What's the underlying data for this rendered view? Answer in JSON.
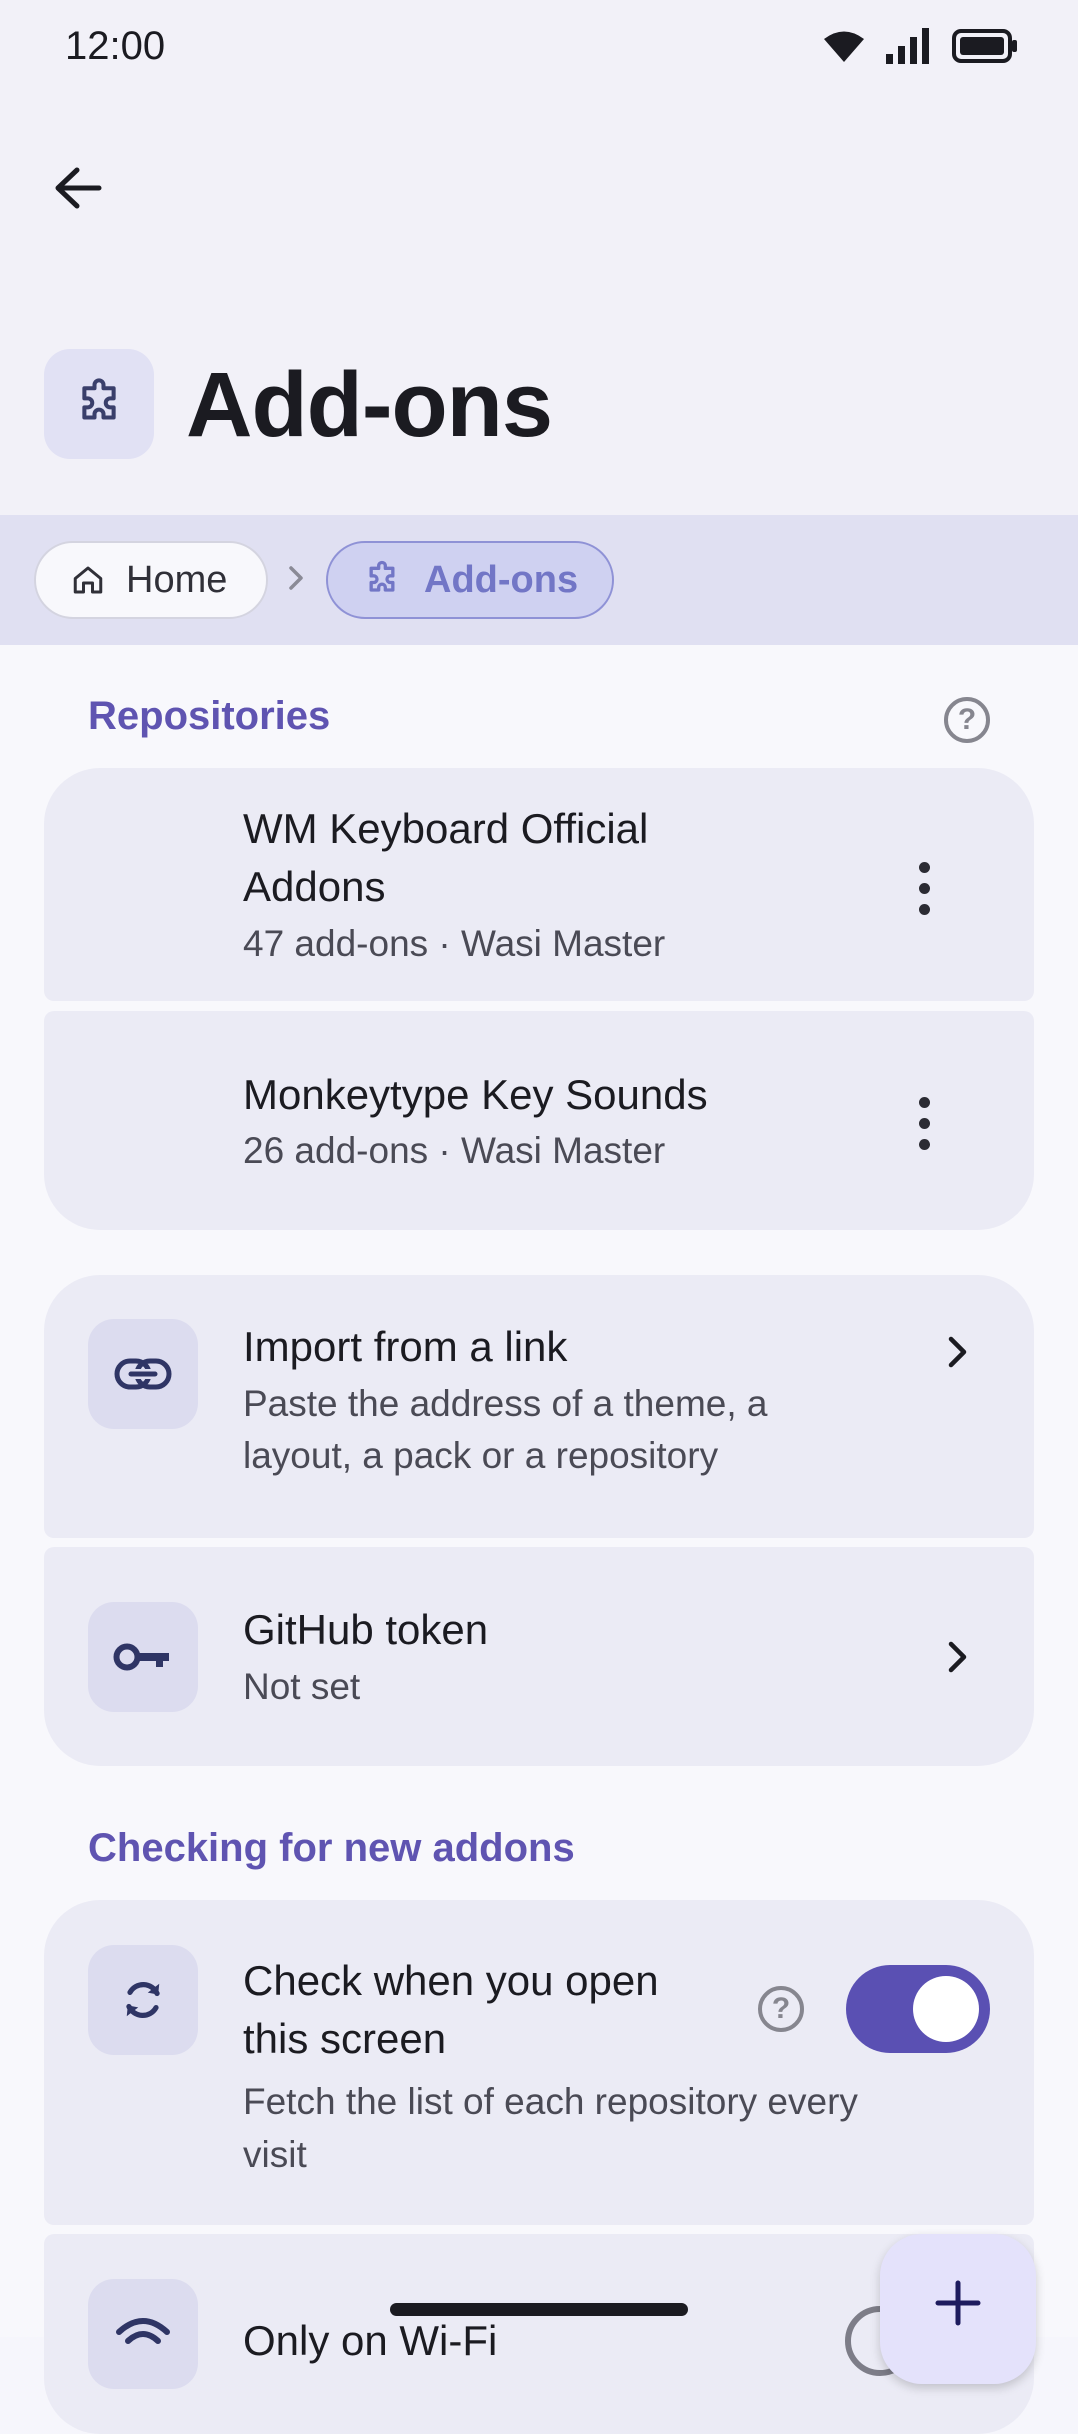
{
  "status_bar": {
    "time": "12:00"
  },
  "header": {
    "title": "Add-ons",
    "title_icon": "puzzle-icon"
  },
  "breadcrumb": {
    "items": [
      {
        "label": "Home",
        "icon": "home-icon"
      },
      {
        "label": "Add-ons",
        "icon": "puzzle-icon"
      }
    ]
  },
  "repositories": {
    "section_title": "Repositories",
    "items": [
      {
        "title_line1": "WM Keyboard Official",
        "title_line2": "Addons",
        "subtitle": "47 add-ons · Wasi Master"
      },
      {
        "title": "Monkeytype Key Sounds",
        "subtitle": "26 add-ons · Wasi Master"
      }
    ]
  },
  "actions": {
    "import": {
      "title": "Import from a link",
      "subtitle_line1": "Paste the address of a theme, a",
      "subtitle_line2": "layout, a pack or a repository",
      "icon": "link-icon"
    },
    "github": {
      "title": "GitHub token",
      "subtitle": "Not set",
      "icon": "key-icon"
    }
  },
  "checking": {
    "section_title": "Checking for new addons",
    "open_screen": {
      "title_line1": "Check when you open",
      "title_line2": "this screen",
      "subtitle_line1": "Fetch the list of each repository every",
      "subtitle_line2": "visit",
      "enabled": true,
      "icon": "sync-icon"
    },
    "wifi": {
      "title": "Only on Wi-Fi",
      "icon": "wifi-icon"
    }
  },
  "fab": {
    "label": "+"
  },
  "colors": {
    "accent": "#5a50b3",
    "section_title": "#5f54b1",
    "card": "#ebebf5"
  }
}
